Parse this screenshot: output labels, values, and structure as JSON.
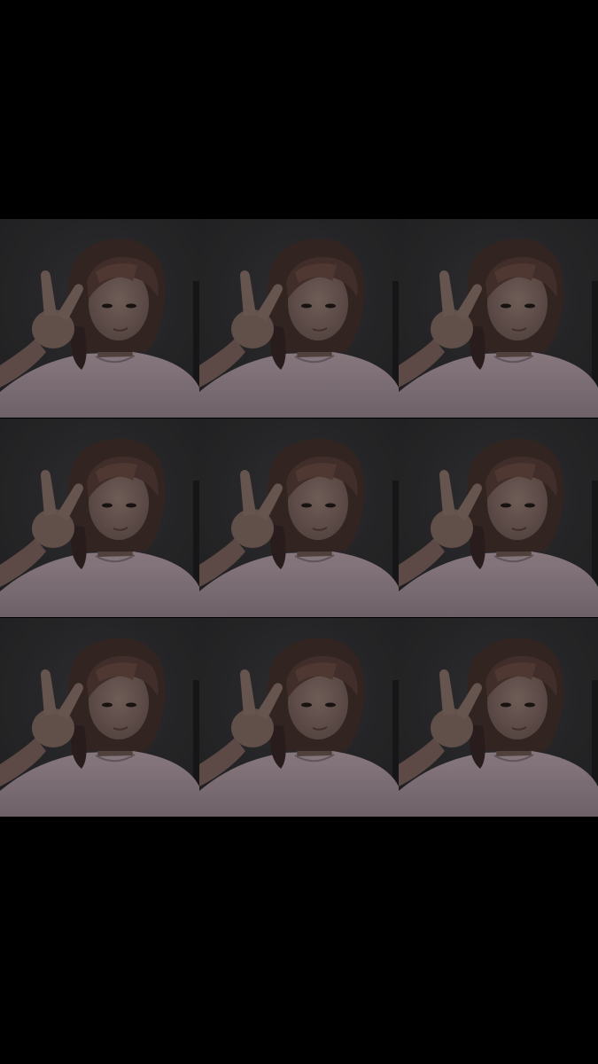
{
  "collage": {
    "rows": 3,
    "columns": 3,
    "tile_count": 9,
    "subject": "selfie-peace-sign",
    "colors": {
      "background": "#000000",
      "wall": "#2b2b2d",
      "skin": "#6f5a55",
      "hair": "#3a2a26",
      "shirt": "#8e7f86",
      "shadow": "#1d1b1c"
    }
  }
}
